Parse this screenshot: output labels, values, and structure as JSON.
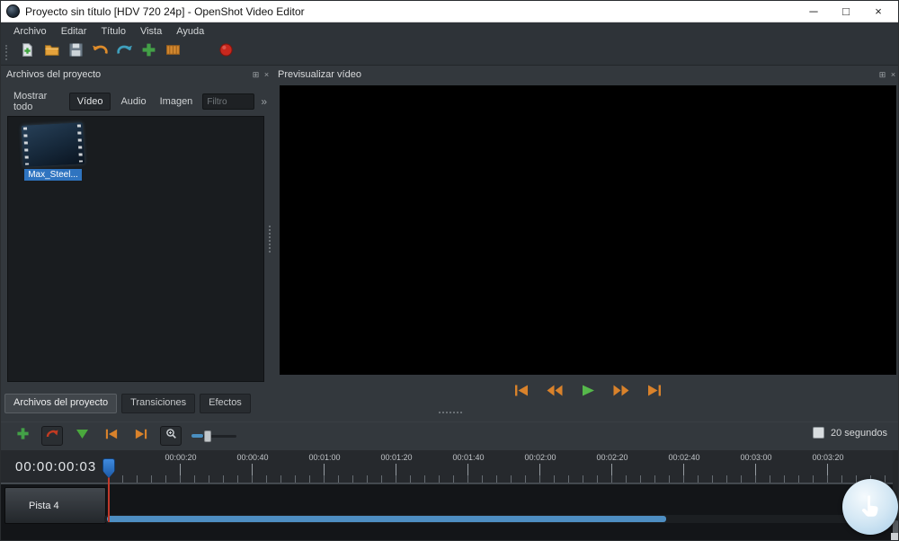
{
  "colors": {
    "accent_blue": "#2f74c0",
    "play_green": "#56b84b",
    "control_orange": "#d9822b",
    "export_red": "#c8281e"
  },
  "window": {
    "title": "Proyecto sin título [HDV 720 24p] - OpenShot Video Editor",
    "minimize": "─",
    "maximize": "□",
    "close": "×"
  },
  "menubar": {
    "items": [
      "Archivo",
      "Editar",
      "Título",
      "Vista",
      "Ayuda"
    ]
  },
  "panels": {
    "project_files": {
      "title": "Archivos del proyecto",
      "float_icon": "⊞",
      "close_icon": "×"
    },
    "preview": {
      "title": "Previsualizar vídeo",
      "float_icon": "⊞",
      "close_icon": "×"
    }
  },
  "filter_bar": {
    "show_all": "Mostrar todo",
    "video": "Vídeo",
    "audio": "Audio",
    "image": "Imagen",
    "filter_placeholder": "Filtro",
    "overflow": "»"
  },
  "files": [
    {
      "name": "Max_Steel..."
    }
  ],
  "bottom_tabs": {
    "project_files": "Archivos del proyecto",
    "transitions": "Transiciones",
    "effects": "Efectos"
  },
  "timeline": {
    "zoom_label": "20 segundos",
    "timecode": "00:00:00:03",
    "ruler_labels": [
      "00:00:20",
      "00:00:40",
      "00:01:00",
      "00:01:20",
      "00:01:40",
      "00:02:00",
      "00:02:20",
      "00:02:40",
      "00:03:00",
      "00:03:20"
    ],
    "tracks": [
      {
        "name": "Pista 4"
      }
    ]
  }
}
